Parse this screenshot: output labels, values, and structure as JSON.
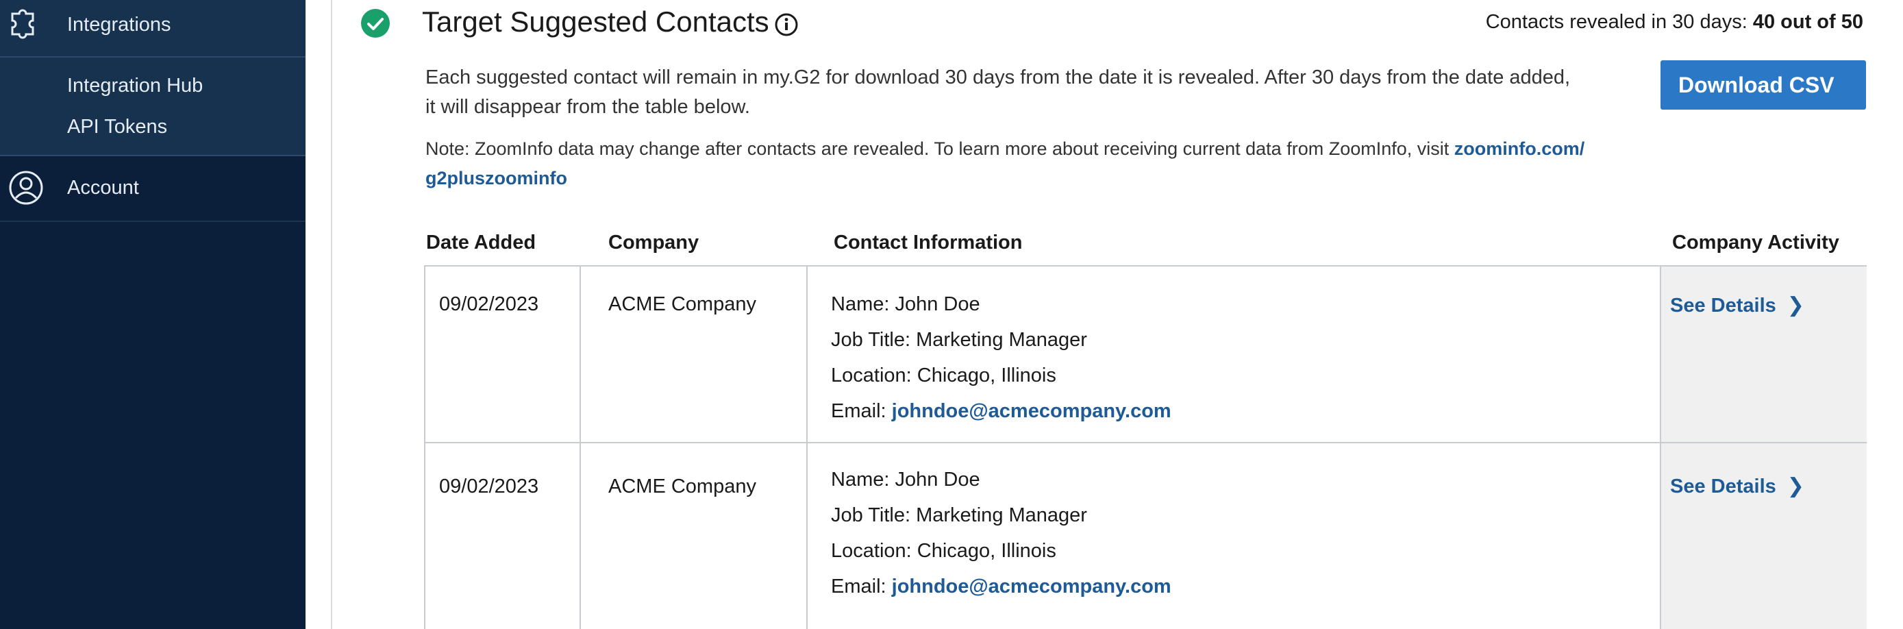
{
  "sidebar": {
    "integrations_label": "Integrations",
    "sub_items": [
      {
        "label": "Integration Hub"
      },
      {
        "label": "API Tokens"
      }
    ],
    "account_label": "Account"
  },
  "header": {
    "title": "Target Suggested Contacts",
    "revealed_prefix": "Contacts revealed in 30 days: ",
    "revealed_count": "40 out of 50"
  },
  "description": {
    "line1": "Each suggested contact will remain in my.G2 for download 30 days from the date it is revealed. After 30 days from the date added,",
    "line2": "it will disappear from the table below.",
    "note_text": "Note: ZoomInfo data may change after contacts are revealed. To learn more about receiving current data from ZoomInfo, visit ",
    "note_link_line1": "zoominfo.com/",
    "note_link_line2": "g2pluszoominfo"
  },
  "actions": {
    "download_label": "Download CSV"
  },
  "table": {
    "columns": [
      "Date Added",
      "Company",
      "Contact Information",
      "Company Activity"
    ],
    "rows": [
      {
        "date": "09/02/2023",
        "company": "ACME Company",
        "name": "Name: John Doe",
        "job_title": "Job Title: Marketing Manager",
        "location": "Location: Chicago, Illinois",
        "email_label": "Email: ",
        "email": "johndoe@acmecompany.com",
        "activity_label": "See Details"
      },
      {
        "date": "09/02/2023",
        "company": "ACME Company",
        "name": "Name: John Doe",
        "job_title": "Job Title: Marketing Manager",
        "location": "Location: Chicago, Illinois",
        "email_label": "Email: ",
        "email": "johndoe@acmecompany.com",
        "activity_label": "See Details"
      }
    ]
  },
  "colors": {
    "sidebar_bg": "#0b1f3a",
    "sidebar_section_bg": "#16324f",
    "accent": "#2b78c6",
    "link": "#1d5a96",
    "success": "#1aa06a"
  },
  "icons": {
    "integrations": "puzzle-icon",
    "account": "user-circle-icon",
    "status": "check-circle-icon",
    "info": "info-icon",
    "chevron": "chevron-right-icon"
  }
}
